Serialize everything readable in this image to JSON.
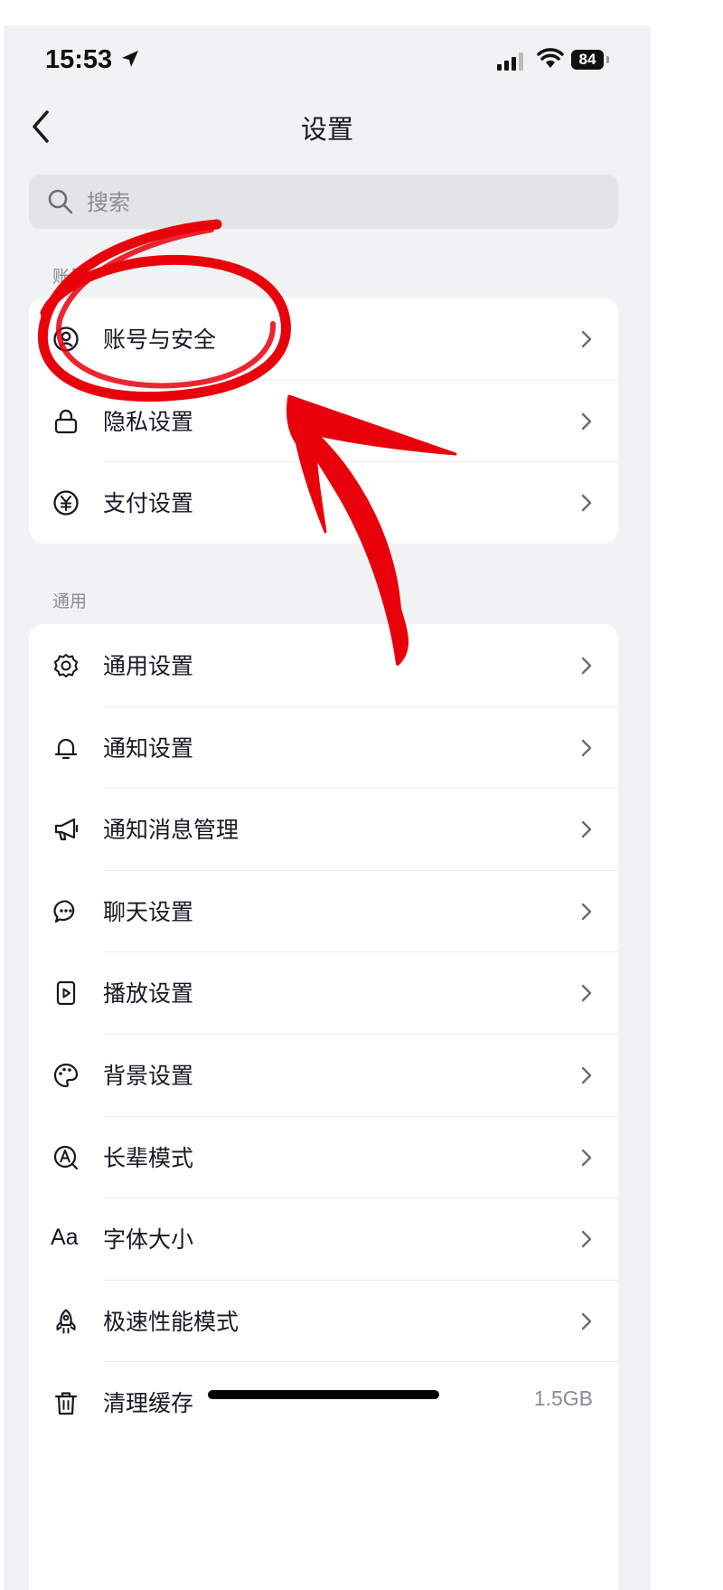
{
  "status_bar": {
    "time": "15:53",
    "battery": "84"
  },
  "nav": {
    "title": "设置"
  },
  "search": {
    "placeholder": "搜索"
  },
  "sections": {
    "account": {
      "label": "账号",
      "items": [
        {
          "label": "账号与安全",
          "icon": "user-circle-icon"
        },
        {
          "label": "隐私设置",
          "icon": "lock-icon"
        },
        {
          "label": "支付设置",
          "icon": "yen-circle-icon"
        }
      ]
    },
    "general": {
      "label": "通用",
      "items": [
        {
          "label": "通用设置",
          "icon": "gear-icon"
        },
        {
          "label": "通知设置",
          "icon": "bell-icon"
        },
        {
          "label": "通知消息管理",
          "icon": "megaphone-icon"
        },
        {
          "label": "聊天设置",
          "icon": "chat-bubble-icon"
        },
        {
          "label": "播放设置",
          "icon": "play-icon"
        },
        {
          "label": "背景设置",
          "icon": "palette-icon"
        },
        {
          "label": "长辈模式",
          "icon": "elder-mode-icon"
        },
        {
          "label": "字体大小",
          "icon": "font-size-icon",
          "icon_text": "Aa"
        },
        {
          "label": "极速性能模式",
          "icon": "rocket-icon"
        },
        {
          "label": "清理缓存",
          "icon": "trash-icon",
          "value": "1.5GB"
        }
      ]
    }
  },
  "annotation": {
    "color": "#e8000b",
    "shape": "circle-and-arrow"
  }
}
